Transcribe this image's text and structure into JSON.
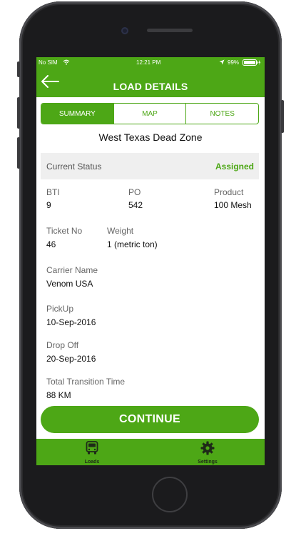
{
  "status_bar": {
    "carrier": "No SIM",
    "time": "12:21 PM",
    "battery": "99%"
  },
  "header": {
    "title": "LOAD DETAILS",
    "back_icon": "arrow-left-icon"
  },
  "tabs": [
    {
      "label": "SUMMARY",
      "active": true
    },
    {
      "label": "MAP",
      "active": false
    },
    {
      "label": "NOTES",
      "active": false
    }
  ],
  "load": {
    "name": "West Texas Dead Zone",
    "current_status_label": "Current Status",
    "current_status_value": "Assigned",
    "bti_label": "BTI",
    "bti_value": "9",
    "po_label": "PO",
    "po_value": "542",
    "product_label": "Product",
    "product_value": "100 Mesh",
    "ticket_label": "Ticket No",
    "ticket_value": "46",
    "weight_label": "Weight",
    "weight_value": "1 (metric ton)",
    "carrier_label": "Carrier Name",
    "carrier_value": "Venom USA",
    "pickup_label": "PickUp",
    "pickup_value": "10-Sep-2016",
    "dropoff_label": "Drop Off",
    "dropoff_value": "20-Sep-2016",
    "transition_label": "Total Transition Time",
    "transition_value": "88 KM"
  },
  "continue_label": "CONTINUE",
  "tabbar": {
    "loads_label": "Loads",
    "loads_icon": "truck-icon",
    "settings_label": "Settings",
    "settings_icon": "gear-icon"
  },
  "colors": {
    "accent": "#4da716"
  }
}
